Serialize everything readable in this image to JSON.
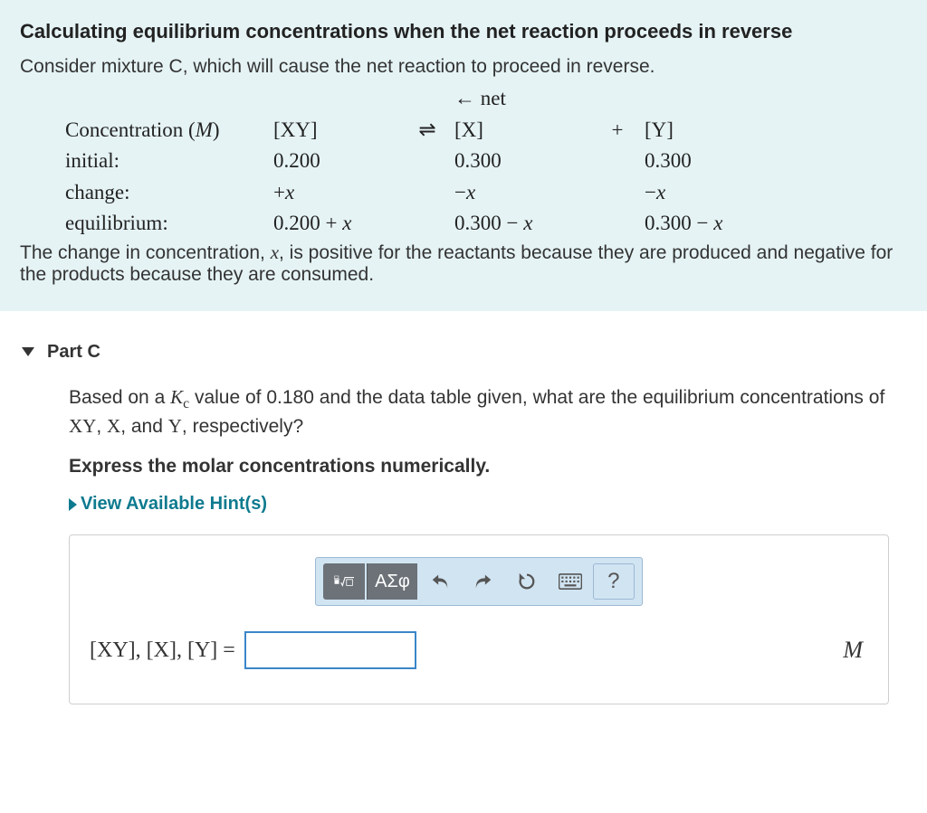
{
  "infobox": {
    "title": "Calculating equilibrium concentrations when the net reaction proceeds in reverse",
    "subtitle": "Consider mixture C, which will cause the net reaction to proceed in reverse.",
    "netLabel": "← net",
    "table": {
      "headerLabel": "Concentration (M)",
      "col1": "[XY]",
      "equilArrow": "⇌",
      "col2": "[X]",
      "plus": "+",
      "col3": "[Y]",
      "row_initial_label": "initial:",
      "row_initial": {
        "xy": "0.200",
        "x": "0.300",
        "y": "0.300"
      },
      "row_change_label": "change:",
      "row_change": {
        "xy": "+x",
        "x": "−x",
        "y": "−x"
      },
      "row_equil_label": "equilibrium:",
      "row_equil": {
        "xy": "0.200 + x",
        "x": "0.300 − x",
        "y": "0.300 − x"
      }
    },
    "footer": "The change in concentration, x, is positive for the reactants because they are produced and negative for the products because they are consumed."
  },
  "partC": {
    "label": "Part C",
    "question_prefix": "Based on a ",
    "kc_symbol": "K",
    "kc_sub": "c",
    "question_mid": " value of 0.180 and the data table given, what are the equilibrium concentrations of ",
    "xy": "XY",
    "x": "X",
    "and": ", and ",
    "y": "Y",
    "question_suffix": ", respectively?",
    "instruction": "Express the molar concentrations numerically.",
    "hints_label": "View Available Hint(s)",
    "toolbar": {
      "greek": "ΑΣφ",
      "undo": "undo",
      "redo": "redo",
      "reset": "reset",
      "keyboard": "keyboard",
      "help": "?"
    },
    "answer_label": "[XY], [X], [Y] =",
    "answer_value": "",
    "unit": "M"
  }
}
